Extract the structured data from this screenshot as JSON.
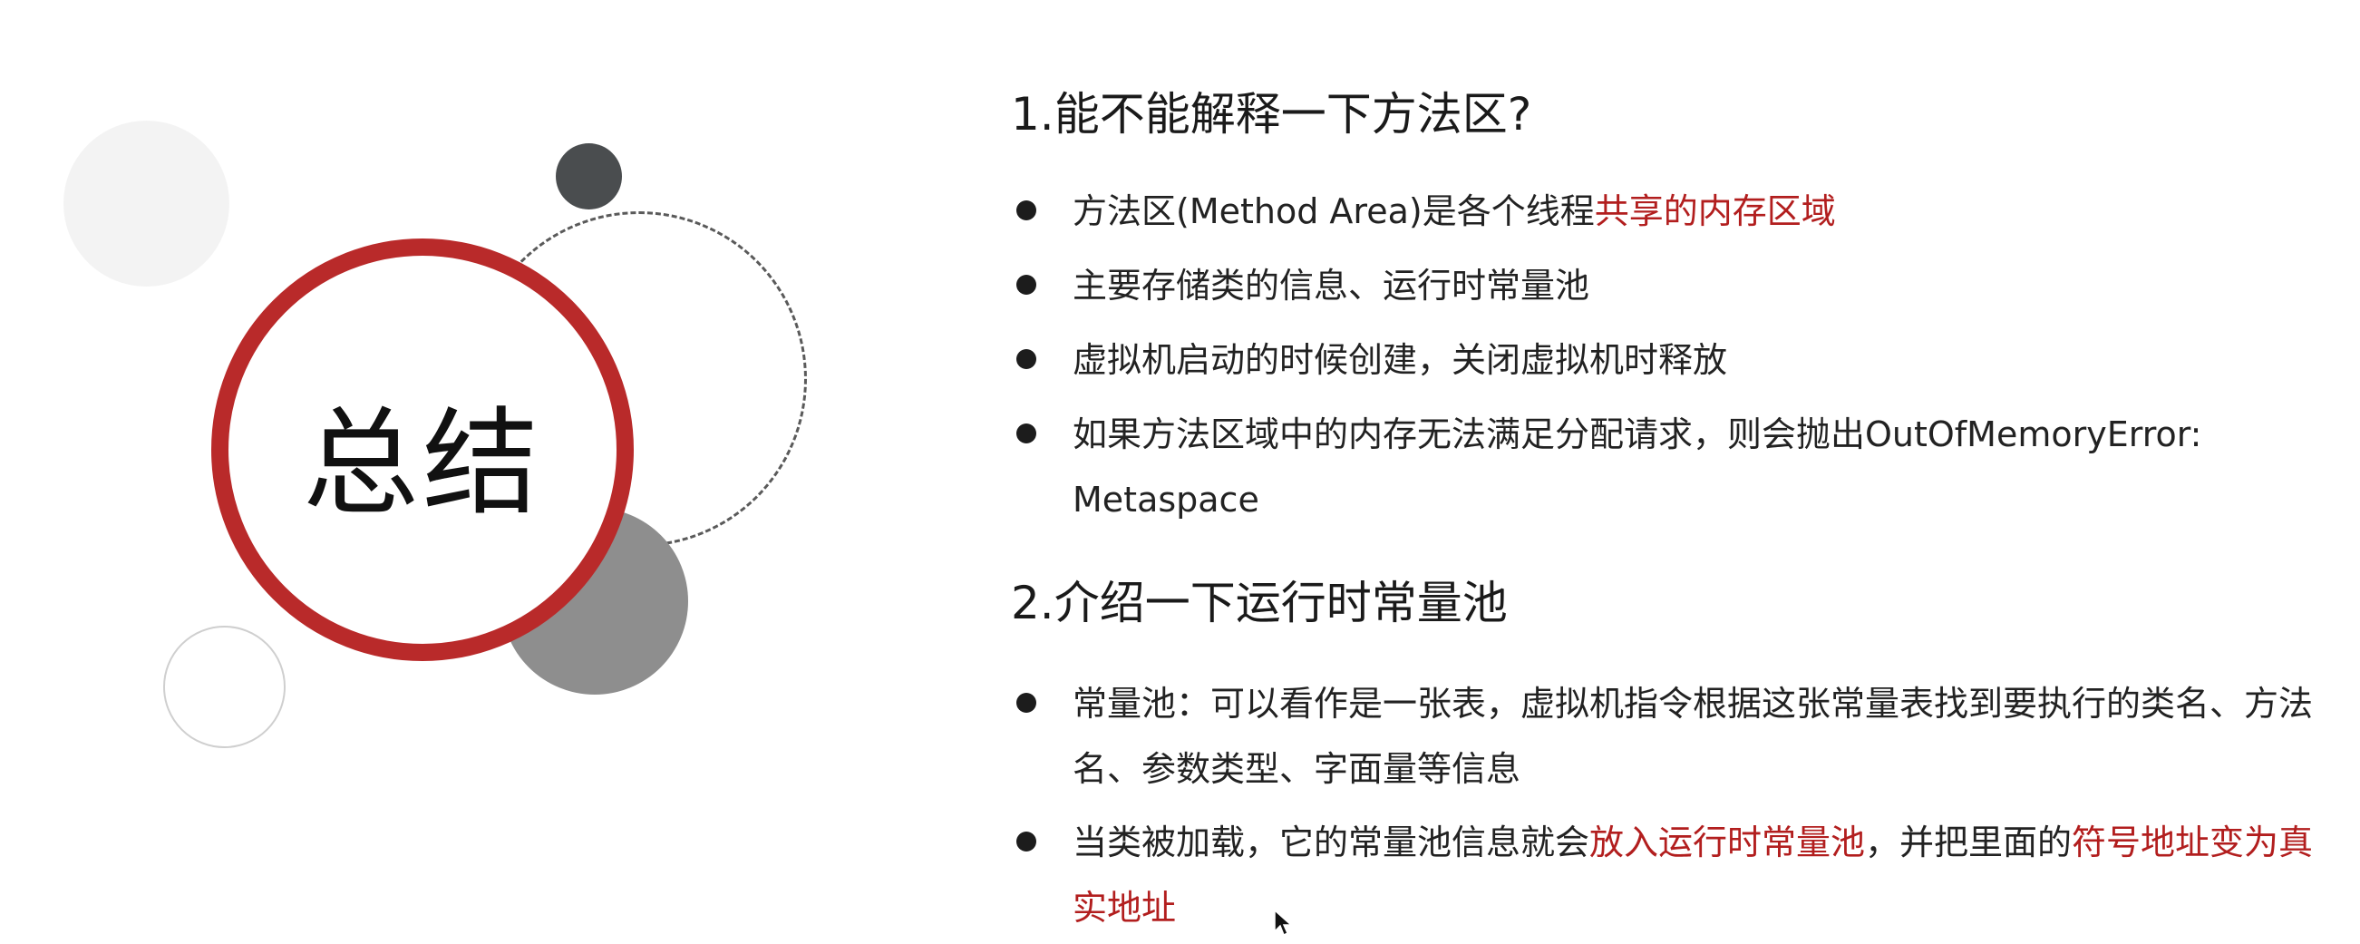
{
  "graphic": {
    "title": "总结"
  },
  "sections": [
    {
      "title": "1.能不能解释一下方法区?",
      "bullets": [
        {
          "segments": [
            "方法区(Method Area)是各个线程",
            "共享的内存区域"
          ]
        },
        {
          "segments": [
            "主要存储类的信息、运行时常量池"
          ]
        },
        {
          "segments": [
            "虚拟机启动的时候创建，关闭虚拟机时释放"
          ]
        },
        {
          "segments": [
            "如果方法区域中的内存无法满足分配请求，则会抛出OutOfMemoryError: Metaspace"
          ]
        }
      ]
    },
    {
      "title": "2.介绍一下运行时常量池",
      "bullets": [
        {
          "segments": [
            "常量池：可以看作是一张表，虚拟机指令根据这张常量表找到要执行的类名、方法名、参数类型、字面量等信息"
          ]
        },
        {
          "segments": [
            "当类被加载，它的常量池信息就会",
            "放入运行时常量池",
            "，并把里面的",
            "符号地址变为真实地址"
          ]
        }
      ]
    }
  ],
  "colors": {
    "accent_red": "#b92a2a",
    "highlight_text": "#b21e1e",
    "dark_dot": "#4a4d4f",
    "gray_circle": "#8e8e8e"
  },
  "icons": {
    "cursor": "mouse-pointer-icon"
  }
}
